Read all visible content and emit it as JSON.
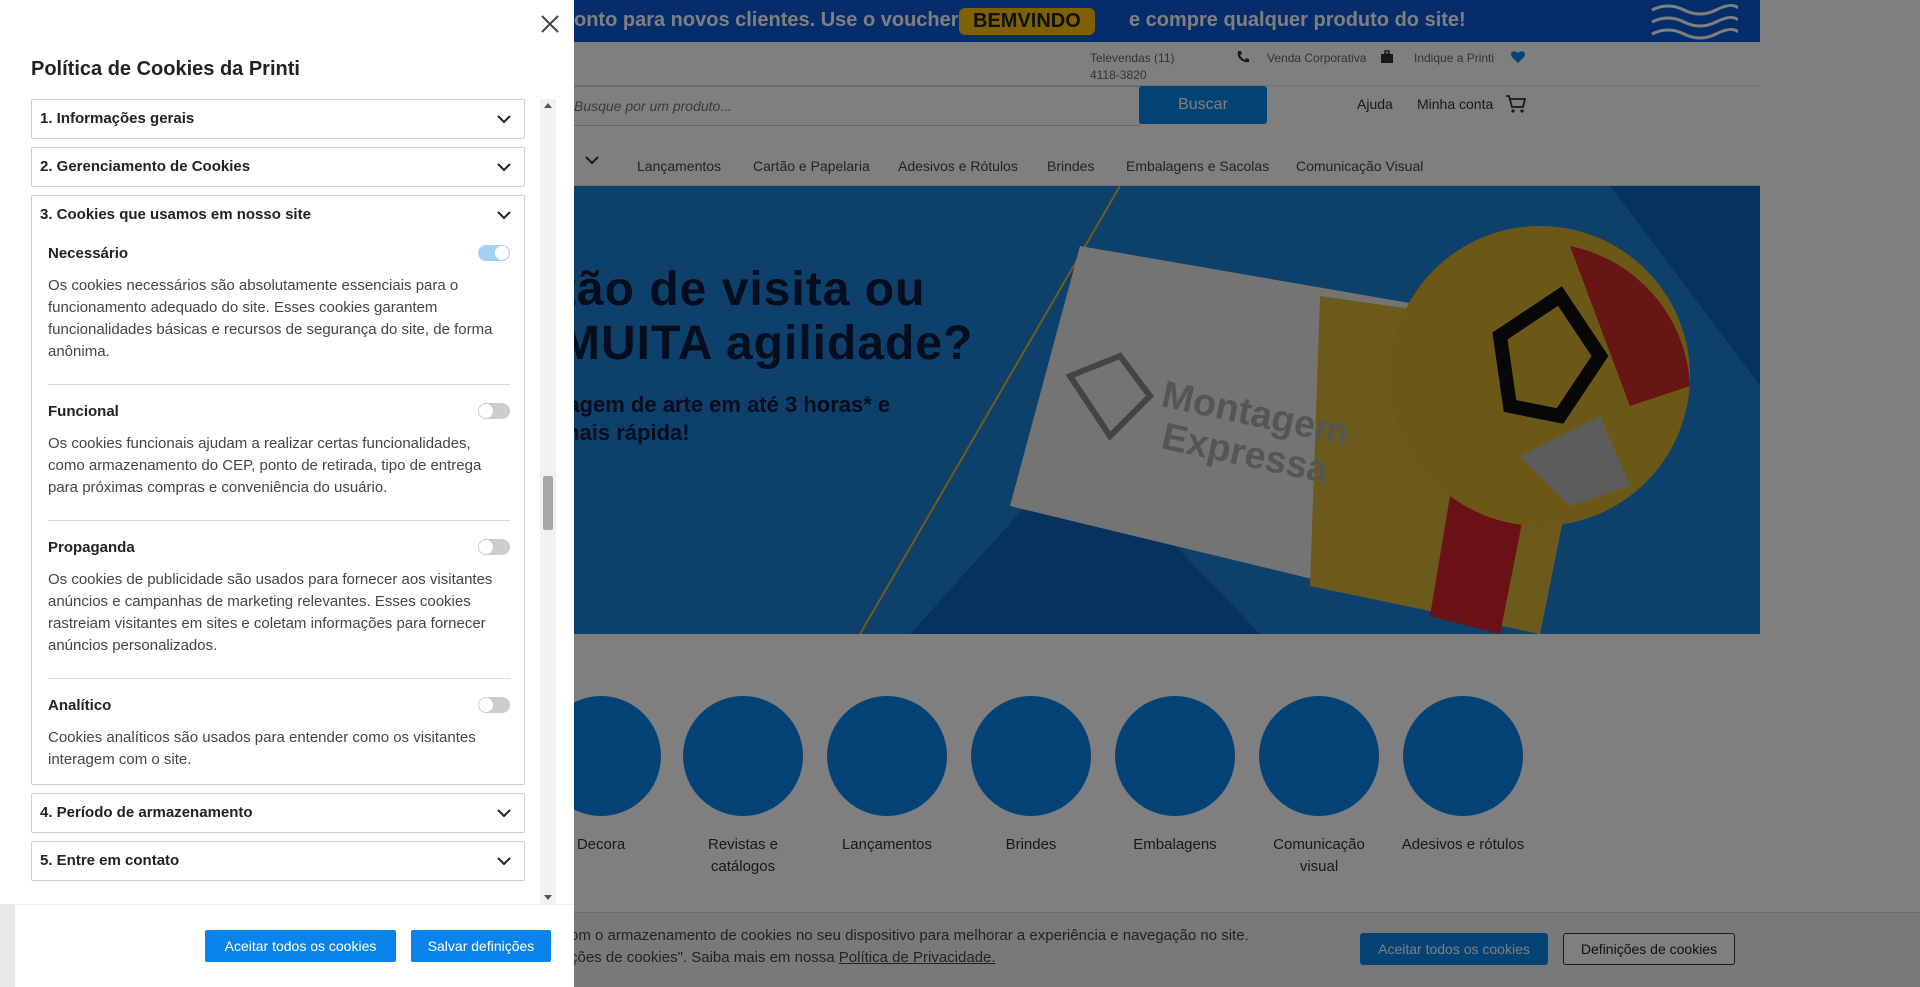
{
  "site": {
    "promo": {
      "text_before": "onto para novos clientes. Use o voucher",
      "voucher": "BEMVINDO",
      "text_after": "e compre qualquer produto do site!"
    },
    "topbar": {
      "televendas": "Televendas (11) 4118-3820",
      "venda_corporativa": "Venda Corporativa",
      "indique": "Indique a Printi"
    },
    "search": {
      "placeholder": "Busque por um produto...",
      "button": "Buscar"
    },
    "header_links": {
      "ajuda": "Ajuda",
      "minha_conta": "Minha conta"
    },
    "nav": [
      "Lançamentos",
      "Cartão e Papelaria",
      "Adesivos e Rótulos",
      "Brindes",
      "Embalagens e Sacolas",
      "Comunicação Visual"
    ],
    "hero": {
      "line1": "tão de visita ou",
      "line2": "MUITA agilidade?",
      "sub1": "tagem de arte em até 3 horas* e",
      "sub2": "mais rápida!",
      "badge_line1": "Montagem",
      "badge_line2": "Expressa"
    },
    "categories": [
      "Decora",
      "Revistas e catálogos",
      "Lançamentos",
      "Brindes",
      "Embalagens",
      "Comunicação visual",
      "Adesivos e rótulos"
    ],
    "cookie_bar": {
      "line1": "om o armazenamento de cookies no seu dispositivo para melhorar a experiência e navegação no site.",
      "line2_prefix": "ções de cookies\". Saiba mais em nossa",
      "privacy_link": "Política de Privacidade.",
      "accept": "Aceitar todos os cookies",
      "settings": "Definições de cookies"
    }
  },
  "panel": {
    "title": "Política de Cookies da Printi",
    "sections": [
      {
        "title": "1. Informações gerais",
        "expanded": false
      },
      {
        "title": "2. Gerenciamento de Cookies",
        "expanded": false
      },
      {
        "title": "3. Cookies que usamos em nosso site",
        "expanded": true
      },
      {
        "title": "4. Período de armazenamento",
        "expanded": false
      },
      {
        "title": "5. Entre em contato",
        "expanded": false
      }
    ],
    "cookie_categories": [
      {
        "name": "Necessário",
        "enabled": true,
        "description": "Os cookies necessários são absolutamente essenciais para o funcionamento adequado do site. Esses cookies garantem funcionalidades básicas e recursos de segurança do site, de forma anônima."
      },
      {
        "name": "Funcional",
        "enabled": false,
        "description": "Os cookies funcionais ajudam a realizar certas funcionalidades, como armazenamento do CEP, ponto de retirada, tipo de entrega para próximas compras e conveniência do usuário."
      },
      {
        "name": "Propaganda",
        "enabled": false,
        "description": "Os cookies de publicidade são usados para fornecer aos visitantes anúncios e campanhas de marketing relevantes. Esses cookies rastreiam visitantes em sites e coletam informações para fornecer anúncios personalizados."
      },
      {
        "name": "Analítico",
        "enabled": false,
        "description": "Cookies analíticos são usados para entender como os visitantes interagem com o site."
      }
    ],
    "footer": {
      "accept_all": "Aceitar todos os cookies",
      "save": "Salvar definições"
    }
  },
  "colors": {
    "accent": "#0a84ea",
    "promo_bg": "#0a58d6",
    "voucher_bg": "#ffc107",
    "toggle_on": "#a5cff3",
    "toggle_off": "#cccccc"
  }
}
